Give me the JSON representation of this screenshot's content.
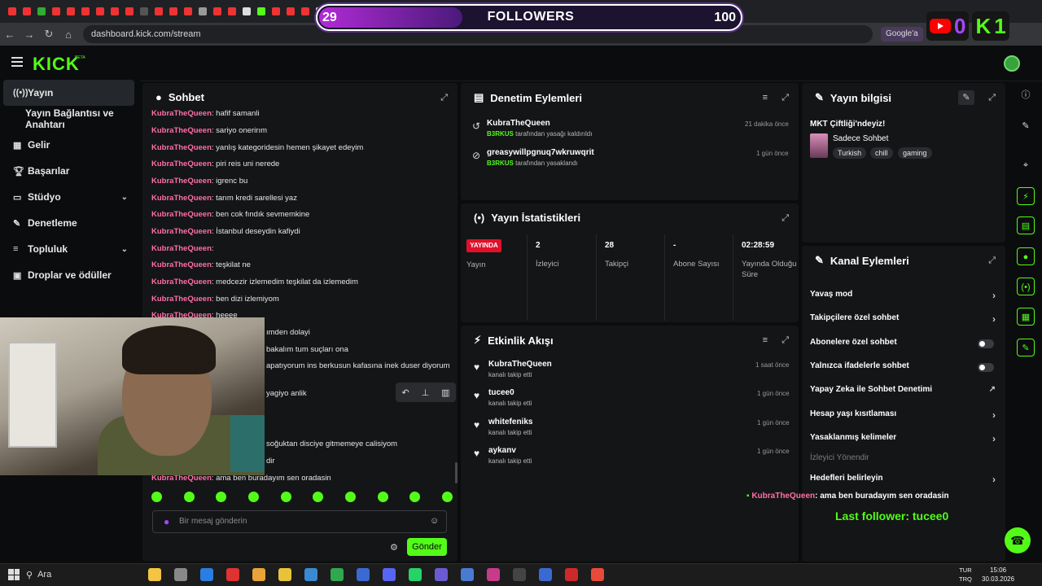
{
  "browser": {
    "url": "dashboard.kick.com/stream",
    "google_chip": "Google'a"
  },
  "overlay": {
    "followers_label": "FOLLOWERS",
    "followers_current": "29",
    "followers_goal": "100",
    "youtube_count": "0",
    "kick_count": "1",
    "chat_user": "KubraTheQueen",
    "chat_text": ": ama ben buradayım sen oradasin",
    "last_follower": "Last follower: tucee0",
    "colors": {
      "accent": "#53fc18",
      "purple": "#a545ff",
      "youtube": "#ff0000"
    }
  },
  "header": {
    "logo": "KICK",
    "beta": "BETA"
  },
  "sidebar": {
    "items": [
      {
        "label": "Yayın",
        "icon": "broadcast-icon"
      },
      {
        "label": "Yayın Bağlantısı ve Anahtarı",
        "icon": ""
      },
      {
        "label": "Gelir",
        "icon": "dollar-icon"
      },
      {
        "label": "Başarılar",
        "icon": "trophy-icon"
      },
      {
        "label": "Stüdyo",
        "icon": "studio-icon"
      },
      {
        "label": "Denetleme",
        "icon": "wrench-icon"
      },
      {
        "label": "Topluluk",
        "icon": "community-icon"
      },
      {
        "label": "Droplar ve ödüller",
        "icon": "gift-icon"
      }
    ]
  },
  "chat": {
    "title": "Sohbet",
    "messages": [
      {
        "user": "KubraTheQueen",
        "text": ": hafif samanli"
      },
      {
        "user": "KubraTheQueen",
        "text": ": sariyo onerirım"
      },
      {
        "user": "KubraTheQueen",
        "text": ": yanlış kategoridesin hemen şikayet edeyim"
      },
      {
        "user": "KubraTheQueen",
        "text": ": piri reis uni nerede"
      },
      {
        "user": "KubraTheQueen",
        "text": ": igrenc bu"
      },
      {
        "user": "KubraTheQueen",
        "text": ": tarım kredi sarellesi yaz"
      },
      {
        "user": "KubraTheQueen",
        "text": ": ben cok fındık sevmemkine"
      },
      {
        "user": "KubraTheQueen",
        "text": ": İstanbul deseydin kafiydi"
      },
      {
        "user": "KubraTheQueen",
        "text": ":"
      },
      {
        "user": "KubraTheQueen",
        "text": ": teşkilat ne"
      },
      {
        "user": "KubraTheQueen",
        "text": ": medcezir izlemedim teşkilat da izlemedim"
      },
      {
        "user": "KubraTheQueen",
        "text": ": ben dizi izlemiyom"
      },
      {
        "user": "KubraTheQueen",
        "text": ": heeee"
      }
    ],
    "partial_lines": [
      "ımden dolayi",
      "bakalım tum suçları ona",
      "apatıyorum ins berkusun kafasına inek duser diyorum",
      "yagiyo anlik",
      "soğuktan disciye gitmemeye calisiyom",
      "dir"
    ],
    "last_message": {
      "user": "KubraTheQueen",
      "text": ": ama ben buradayım sen oradasin"
    },
    "input_placeholder": "Bir mesaj gönderin",
    "send_label": "Gönder"
  },
  "mod": {
    "title": "Denetim Eylemleri",
    "rows": [
      {
        "name": "KubraTheQueen",
        "actor": "B3RKUS",
        "action": "tarafından yasağı kaldırıldı",
        "time": "21 dakika önce",
        "icon": "undo-icon"
      },
      {
        "name": "greasywillpgnuq7wkruwqrit",
        "actor": "B3RKUS",
        "action": "tarafından yasaklandı",
        "time": "1 gün önce",
        "icon": "ban-icon"
      }
    ]
  },
  "stats": {
    "title": "Yayın İstatistikleri",
    "live_badge": "YAYINDA",
    "live_label": "Yayın",
    "items": [
      {
        "value": "2",
        "label": "İzleyici"
      },
      {
        "value": "28",
        "label": "Takipçi"
      },
      {
        "value": "-",
        "label": "Abone Sayısı"
      },
      {
        "value": "02:28:59",
        "label": "Yayında Olduğu Süre"
      }
    ]
  },
  "activity": {
    "title": "Etkinlik Akışı",
    "rows": [
      {
        "name": "KubraTheQueen",
        "sub": "kanalı takip etti",
        "time": "1 saat önce"
      },
      {
        "name": "tucee0",
        "sub": "kanalı takip etti",
        "time": "1 gün önce"
      },
      {
        "name": "whitefeniks",
        "sub": "kanalı takip etti",
        "time": "1 gün önce"
      },
      {
        "name": "aykanv",
        "sub": "kanalı takip etti",
        "time": "1 gün önce"
      }
    ]
  },
  "info": {
    "title": "Yayın bilgisi",
    "stream_title": "MKT Çiftliği'ndeyiz!",
    "category": "Sadece Sohbet",
    "tags": [
      "Turkish",
      "chill",
      "gaming"
    ]
  },
  "channel": {
    "title": "Kanal Eylemleri",
    "rows": [
      {
        "label": "Yavaş mod",
        "control": "arrow"
      },
      {
        "label": "Takipçilere özel sohbet",
        "control": "arrow"
      },
      {
        "label": "Abonelere özel sohbet",
        "control": "toggle",
        "on": false
      },
      {
        "label": "Yalnızca ifadelerle sohbet",
        "control": "toggle",
        "on": false
      },
      {
        "label": "Yapay Zeka ile Sohbet Denetimi",
        "control": "external"
      },
      {
        "label": "Hesap yaşı kısıtlaması",
        "control": "arrow"
      },
      {
        "label": "Yasaklanmış kelimeler",
        "control": "arrow"
      }
    ],
    "section_label": "İzleyici Yönendir",
    "target_row": "Hedefleri belirleyin"
  },
  "taskbar": {
    "search_label": "Ara",
    "lang_top": "TUR",
    "lang_bottom": "TRQ",
    "time": "15:06",
    "date": "30.03.2026"
  }
}
